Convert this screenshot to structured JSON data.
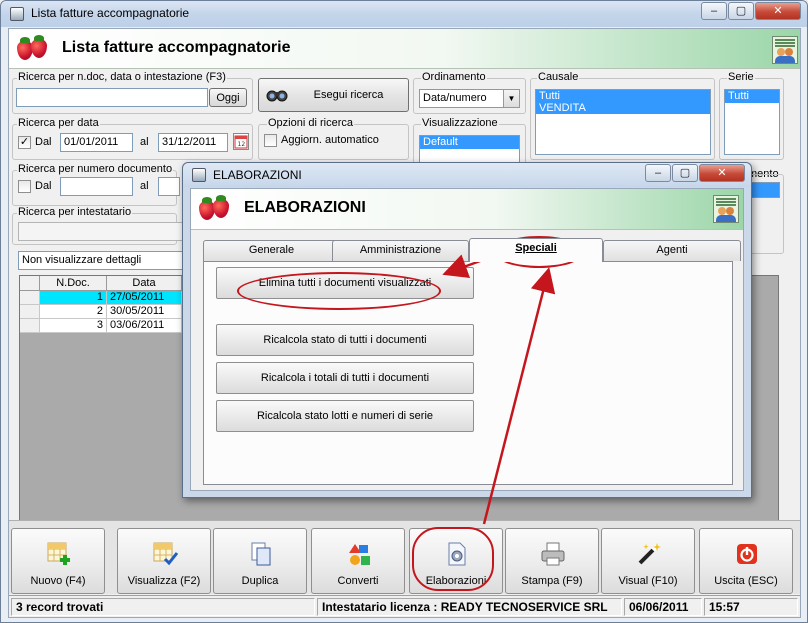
{
  "window": {
    "title": "Lista fatture accompagnatorie",
    "header_title": "Lista fatture accompagnatorie"
  },
  "search": {
    "doc_group_label": "Ricerca per n.doc, data o intestazione (F3)",
    "doc_value": "",
    "oggi_label": "Oggi",
    "esegui_label": "Esegui ricerca",
    "date_group_label": "Ricerca per data",
    "dal_label": "Dal",
    "al_label": "al",
    "date_from": "01/01/2011",
    "date_to": "31/12/2011",
    "date_checked": "✓",
    "number_group_label": "Ricerca per numero documento",
    "num_dal_label": "Dal",
    "num_al_label": "al",
    "holder_group_label": "Ricerca per intestatario",
    "details_value": "Non visualizzare dettagli"
  },
  "options": {
    "group_label": "Opzioni di ricerca",
    "auto_update_label": "Aggiorn. automatico"
  },
  "ordering": {
    "group_label": "Ordinamento",
    "value": "Data/numero"
  },
  "view": {
    "group_label": "Visualizzazione",
    "value": "Default"
  },
  "causale": {
    "group_label": "Causale",
    "items": [
      "Tutti",
      "VENDITA"
    ]
  },
  "serie": {
    "group_label": "Serie",
    "items": [
      "Tutti"
    ],
    "partial_label": "mento"
  },
  "grid": {
    "columns": [
      "N.Doc.",
      "Data"
    ],
    "rows": [
      {
        "num": "1",
        "date": "27/05/2011"
      },
      {
        "num": "2",
        "date": "30/05/2011"
      },
      {
        "num": "3",
        "date": "03/06/2011"
      }
    ]
  },
  "toolbar": [
    {
      "label": "Nuovo (F4)"
    },
    {
      "label": "Visualizza (F2)"
    },
    {
      "label": "Duplica"
    },
    {
      "label": "Converti"
    },
    {
      "label": "Elaborazioni"
    },
    {
      "label": "Stampa (F9)"
    },
    {
      "label": "Visual (F10)"
    },
    {
      "label": "Uscita (ESC)"
    }
  ],
  "status": {
    "records": "3 record trovati",
    "license": "Intestatario licenza : READY TECNOSERVICE SRL",
    "date": "06/06/2011",
    "time": "15:57"
  },
  "dialog": {
    "title": "ELABORAZIONI",
    "header_title": "ELABORAZIONI",
    "tabs": [
      "Generale",
      "Amministrazione",
      "Speciali",
      "Agenti"
    ],
    "actions": [
      "Elimina tutti i documenti visualizzati",
      "Ricalcola stato di tutti i documenti",
      "Ricalcola i totali di tutti i documenti",
      "Ricalcola stato lotti e numeri di serie"
    ]
  },
  "colors": {
    "selection": "#3399ff",
    "annotation": "#c4161c",
    "header_green": "#9bd6a8"
  }
}
